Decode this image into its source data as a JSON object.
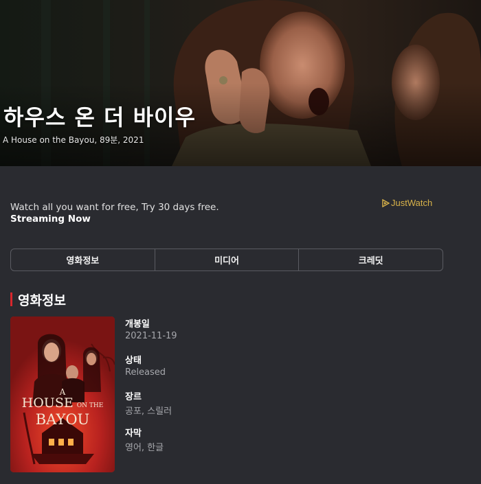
{
  "hero": {
    "title": "하우스 온 더 바이우",
    "subtitle": "A House on the Bayou, 89분, 2021"
  },
  "promo": {
    "text": "Watch all you want for free, Try 30 days free. ",
    "highlight": "Streaming Now"
  },
  "justwatch": {
    "label": "JustWatch",
    "color": "#d9b34a"
  },
  "tabs": [
    {
      "label": "영화정보"
    },
    {
      "label": "미디어"
    },
    {
      "label": "크레딧"
    }
  ],
  "section": {
    "title": "영화정보",
    "accent": "#d8262c"
  },
  "poster": {
    "title_a": "A",
    "title_house": "HOUSE",
    "title_on_the": "ON THE",
    "title_bayou": "BAYOU"
  },
  "info": [
    {
      "label": "개봉일",
      "value": "2021-11-19"
    },
    {
      "label": "상태",
      "value": "Released"
    },
    {
      "label": "장르",
      "value": "공포, 스릴러"
    },
    {
      "label": "자막",
      "value": "영어, 한글"
    }
  ],
  "colors": {
    "background": "#2a2b30",
    "border": "#5b5c62",
    "muted_text": "#a7a8ad"
  }
}
